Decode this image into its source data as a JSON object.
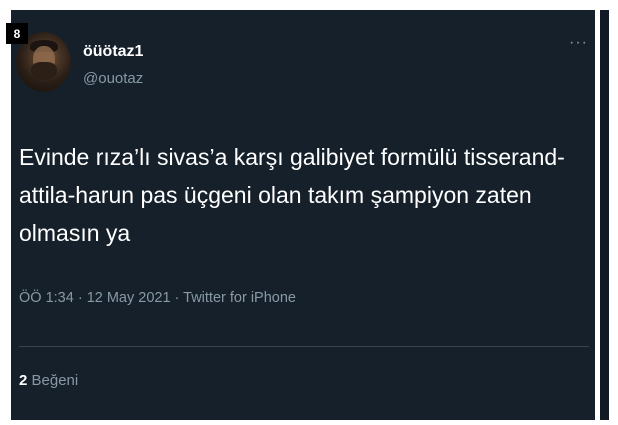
{
  "overlay_badge": "8",
  "author": {
    "display_name": "öüötaz1",
    "handle": "@ouotaz",
    "avatar_icon": "avatar-photo"
  },
  "more_icon": "more-options-icon",
  "tweet": {
    "lines": [
      "Evinde rıza’lı sivas’a karşı galibiyet formülü tisserand-",
      "attila-harun pas üçgeni olan takım şampiyon zaten",
      "olmasın ya"
    ]
  },
  "meta": {
    "text": "ÖÖ 1:34 · 12 May 2021 · Twitter for iPhone"
  },
  "stats": {
    "like_count": "2",
    "like_label": "Beğeni"
  },
  "colors": {
    "background": "#15202b",
    "text": "#ffffff",
    "muted": "#8899a6",
    "divider": "#38444d"
  }
}
